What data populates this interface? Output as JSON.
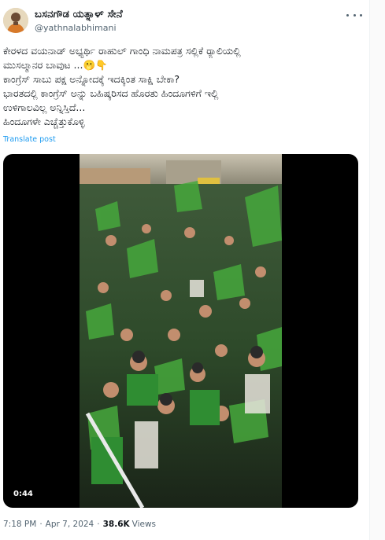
{
  "author": {
    "display_name": "ಬಸನಗೌಡ ಯತ್ನಾಳ್ ಸೇನೆ",
    "handle": "@yathnalabhimani"
  },
  "post": {
    "lines": [
      "ಕೇರಳದ ವಯನಾಡ್ ಅಭ್ಯರ್ಥಿ ರಾಹುಲ್ ಗಾಂಧಿ ನಾಮಪತ್ರ ಸಲ್ಲಿಕೆ ರ್‍ಯಾಲಿಯಲ್ಲಿ",
      "ಮುಸಲ್ಮಾನರ ಬಾವುಟ ...🫢👇",
      "ಕಾಂಗ್ರೆಸ್ ಸಾಬು ಪಕ್ಷ ಅನ್ನೋದಕ್ಕೆ ಇದಕ್ಕಿಂತ ಸಾಕ್ಷಿ ಬೇಕಾ?",
      "ಭಾರತದಲ್ಲಿ ಕಾಂಗ್ರೆಸ್ ಅನ್ನು ಬಹಿಷ್ಕರಿಸದ ಹೊರತು ಹಿಂದೂಗಳಿಗೆ ಇಲ್ಲಿ",
      "ಉಳಿಗಾಲವಿಲ್ಲ ಅನ್ನಿಸ್ತಿದೆ...",
      "ಹಿಂದೂಗಳೇ ಎಚ್ಚೆತ್ತುಕೊಳ್ಳಿ"
    ],
    "translate_label": "Translate post"
  },
  "media": {
    "duration": "0:44"
  },
  "meta": {
    "time": "7:18 PM",
    "date": "Apr 7, 2024",
    "views_count": "38.6K",
    "views_label": "Views"
  },
  "icons": [
    "more-options-icon"
  ]
}
